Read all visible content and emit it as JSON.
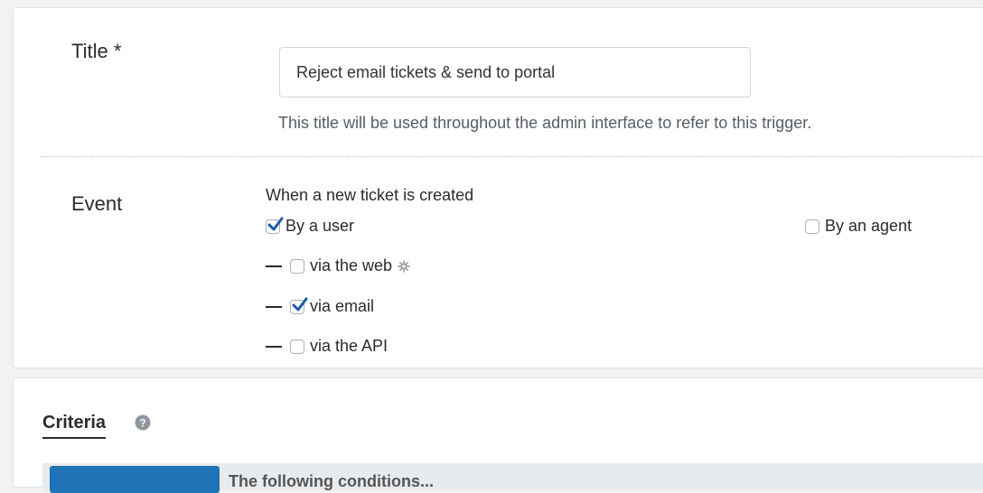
{
  "form": {
    "title_label": "Title *",
    "title_value": "Reject email tickets & send to portal",
    "title_help": "This title will be used throughout the admin interface to refer to this trigger.",
    "event_label": "Event",
    "event_heading": "When a new ticket is created",
    "options": {
      "by_user": {
        "label": "By a user",
        "checked": true
      },
      "by_agent": {
        "label": "By an agent",
        "checked": false
      },
      "via_web": {
        "label": "via the web",
        "checked": false
      },
      "via_email": {
        "label": "via email",
        "checked": true
      },
      "via_api": {
        "label": "via the API",
        "checked": false
      }
    }
  },
  "criteria": {
    "title": "Criteria",
    "strip_text": "The following conditions..."
  },
  "colors": {
    "check": "#1f5ba8",
    "primary_button": "#1f73b7"
  },
  "icons": [
    "gear-icon",
    "help-circle-icon",
    "checkmark-icon"
  ]
}
